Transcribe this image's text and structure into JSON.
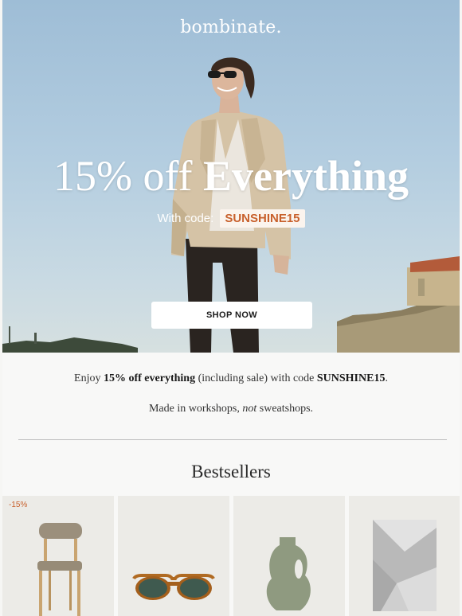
{
  "brand": {
    "logo": "bombinate."
  },
  "hero": {
    "headline_light": "15% off ",
    "headline_bold": "Everything",
    "code_label": "With code:",
    "code": "SUNSHINE15",
    "cta": "SHOP NOW"
  },
  "intro": {
    "line1_pre": "Enjoy ",
    "line1_bold": "15% off everything",
    "line1_mid": " (including sale) with code ",
    "line1_code": "SUNSHINE15",
    "line1_end": ".",
    "line2_pre": "Made in workshops, ",
    "line2_em": "not",
    "line2_end": " sweatshops."
  },
  "bestsellers": {
    "title": "Bestsellers",
    "products": [
      {
        "badge": "-15%",
        "icon": "chair-icon"
      },
      {
        "badge": "",
        "icon": "sunglasses-icon"
      },
      {
        "badge": "",
        "icon": "vase-icon"
      },
      {
        "badge": "",
        "icon": "rug-icon"
      }
    ]
  },
  "colors": {
    "accent": "#c8602c",
    "background": "#f8f8f7"
  }
}
